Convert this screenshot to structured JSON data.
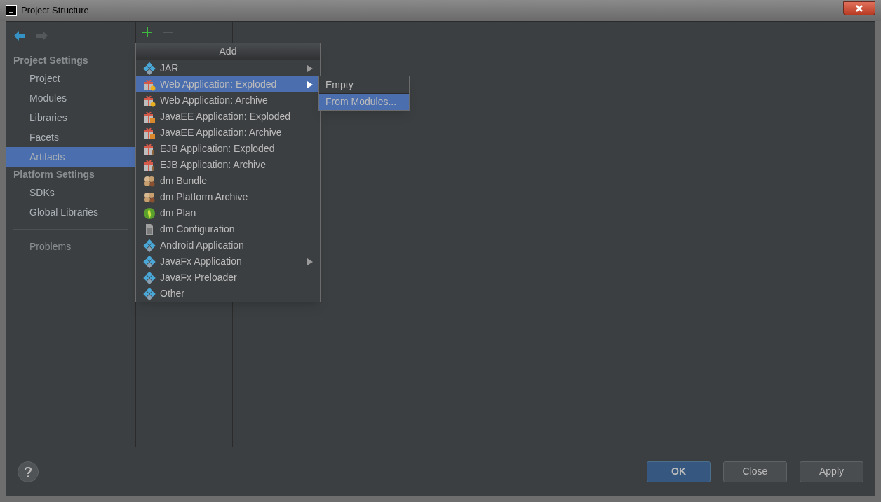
{
  "window": {
    "title": "Project Structure"
  },
  "sidebar": {
    "sections": [
      {
        "title": "Project Settings",
        "items": [
          {
            "label": "Project",
            "selected": false
          },
          {
            "label": "Modules",
            "selected": false
          },
          {
            "label": "Libraries",
            "selected": false
          },
          {
            "label": "Facets",
            "selected": false
          },
          {
            "label": "Artifacts",
            "selected": true
          }
        ]
      },
      {
        "title": "Platform Settings",
        "items": [
          {
            "label": "SDKs",
            "selected": false
          },
          {
            "label": "Global Libraries",
            "selected": false
          }
        ]
      }
    ],
    "bottom_items": [
      {
        "label": "Problems",
        "selected": false
      }
    ]
  },
  "toolbar": {
    "remove_disabled": true
  },
  "add_menu": {
    "title": "Add",
    "items": [
      {
        "label": "JAR",
        "kind": "diamond",
        "submenu": true,
        "selected": false
      },
      {
        "label": "Web Application: Exploded",
        "kind": "web",
        "submenu": true,
        "selected": true
      },
      {
        "label": "Web Application: Archive",
        "kind": "web",
        "submenu": false,
        "selected": false
      },
      {
        "label": "JavaEE Application: Exploded",
        "kind": "javaee",
        "submenu": false,
        "selected": false
      },
      {
        "label": "JavaEE Application: Archive",
        "kind": "javaee",
        "submenu": false,
        "selected": false
      },
      {
        "label": "EJB Application: Exploded",
        "kind": "ejb",
        "submenu": false,
        "selected": false
      },
      {
        "label": "EJB Application: Archive",
        "kind": "ejb",
        "submenu": false,
        "selected": false
      },
      {
        "label": "dm Bundle",
        "kind": "bundle",
        "submenu": false,
        "selected": false
      },
      {
        "label": "dm Platform Archive",
        "kind": "bundle",
        "submenu": false,
        "selected": false
      },
      {
        "label": "dm Plan",
        "kind": "plan",
        "submenu": false,
        "selected": false
      },
      {
        "label": "dm Configuration",
        "kind": "doc",
        "submenu": false,
        "selected": false
      },
      {
        "label": "Android Application",
        "kind": "diamond",
        "submenu": false,
        "selected": false
      },
      {
        "label": "JavaFx Application",
        "kind": "diamond",
        "submenu": true,
        "selected": false
      },
      {
        "label": "JavaFx Preloader",
        "kind": "diamond",
        "submenu": false,
        "selected": false
      },
      {
        "label": "Other",
        "kind": "diamond",
        "submenu": false,
        "selected": false
      }
    ]
  },
  "submenu": {
    "items": [
      {
        "label": "Empty",
        "selected": false
      },
      {
        "label": "From Modules...",
        "selected": true
      }
    ]
  },
  "buttons": [
    {
      "label": "OK",
      "default": true
    },
    {
      "label": "Close",
      "default": false
    },
    {
      "label": "Apply",
      "default": false
    }
  ]
}
